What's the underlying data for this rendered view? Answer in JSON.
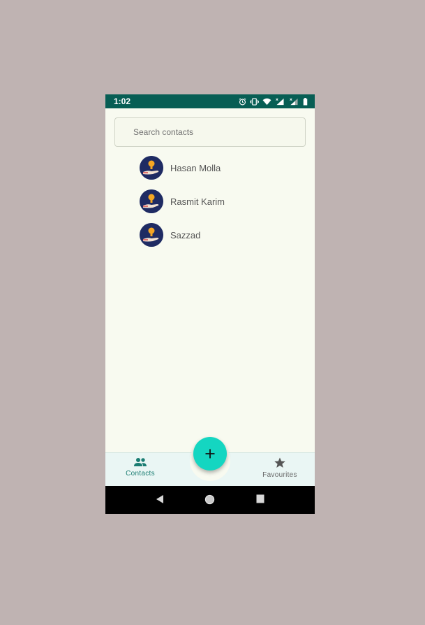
{
  "status_bar": {
    "time": "1:02",
    "icons": [
      "alarm-icon",
      "vibrate-icon",
      "wifi-icon",
      "signal-icon",
      "signal-icon",
      "battery-icon"
    ]
  },
  "search": {
    "placeholder": "Search contacts",
    "value": ""
  },
  "contacts": [
    {
      "name": "Hasan Molla",
      "avatar": "lightbulb-hand-avatar"
    },
    {
      "name": "Rasmit Karim",
      "avatar": "lightbulb-hand-avatar"
    },
    {
      "name": "Sazzad",
      "avatar": "lightbulb-hand-avatar"
    }
  ],
  "bottom_nav": {
    "contacts_label": "Contacts",
    "favourites_label": "Favourites",
    "active": "Contacts"
  },
  "fab": {
    "icon": "plus-icon"
  },
  "colors": {
    "status_bar": "#075e54",
    "accent": "#14d6c1",
    "active_nav": "#1b7d72",
    "background": "#f8faf0",
    "avatar_bg": "#1f2b63"
  }
}
